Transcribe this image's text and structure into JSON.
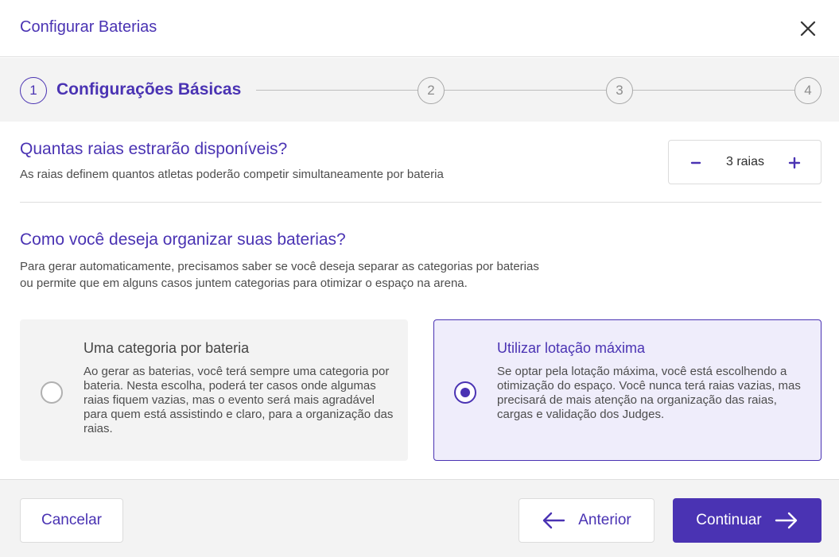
{
  "dialog": {
    "title": "Configurar Baterias",
    "close_icon": "close-icon"
  },
  "stepper": {
    "steps": [
      {
        "number": "1",
        "label": "Configurações Básicas",
        "active": true
      },
      {
        "number": "2",
        "label": "",
        "active": false
      },
      {
        "number": "3",
        "label": "",
        "active": false
      },
      {
        "number": "4",
        "label": "",
        "active": false
      }
    ]
  },
  "lanes": {
    "question": "Quantas raias estrarão disponíveis?",
    "description": "As raias definem quantos atletas poderão competir simultaneamente por bateria",
    "value": "3 raias",
    "minus_icon": "minus-icon",
    "plus_icon": "plus-icon"
  },
  "organization": {
    "question": "Como você deseja organizar suas baterias?",
    "description_line1": "Para gerar automaticamente, precisamos saber se você deseja separar as categorias por baterias",
    "description_line2": "ou permite que em alguns casos juntem categorias para otimizar o espaço na arena.",
    "options": [
      {
        "title": "Uma categoria por bateria",
        "text": "Ao gerar as baterias, você terá sempre uma categoria por bateria. Nesta escolha, poderá ter casos onde algumas raias fiquem vazias, mas o evento será mais agradável para quem está assistindo e claro, para a organização das raias.",
        "selected": false
      },
      {
        "title": "Utilizar lotação máxima",
        "text": "Se optar pela lotação máxima, você está escolhendo a otimização do espaço. Você nunca terá raias vazias, mas precisará de mais atenção na organização das raias, cargas e validação dos Judges.",
        "selected": true
      }
    ]
  },
  "footer": {
    "cancel_label": "Cancelar",
    "previous_label": "Anterior",
    "continue_label": "Continuar"
  },
  "colors": {
    "accent": "#4a33b3",
    "selected_card_bg": "#efedfb",
    "panel_bg": "#f3f3f3"
  }
}
